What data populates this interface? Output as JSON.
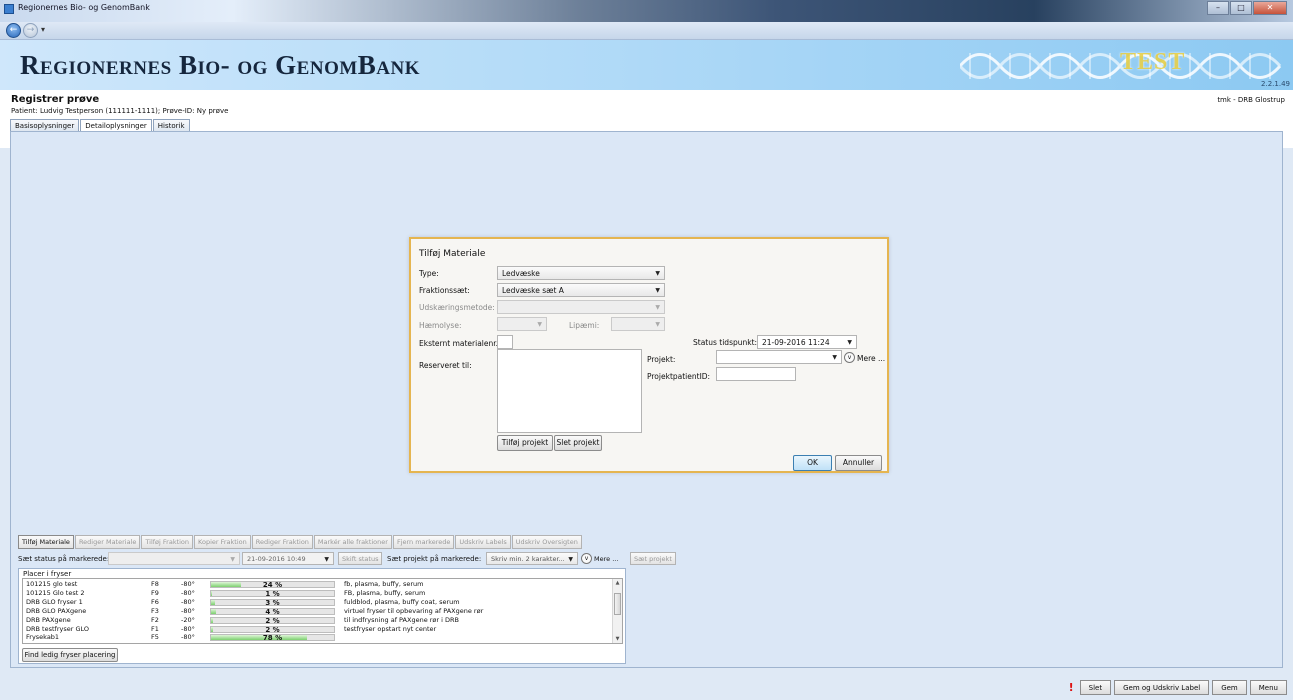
{
  "window": {
    "title": "Regionernes Bio- og GenomBank"
  },
  "nav": {
    "back_glyph": "←",
    "fwd_glyph": "→",
    "dropdown_glyph": "▾"
  },
  "banner": {
    "brand": "Regionernes Bio- og GenomBank",
    "test_badge": "TEST",
    "version": "2.2.1.49"
  },
  "page": {
    "title": "Registrer prøve",
    "patient": "Patient: Ludvig Testperson (111111-1111); Prøve-ID: Ny prøve",
    "user": "tmk - DRB Glostrup",
    "tabs": [
      "Basisoplysninger",
      "Detailoplysninger",
      "Historik"
    ]
  },
  "dialog": {
    "title": "Tilføj Materiale",
    "type_label": "Type:",
    "type_value": "Ledvæske",
    "fraktion_label": "Fraktionssæt:",
    "fraktion_value": "Ledvæske sæt A",
    "udskaering_label": "Udskæringsmetode:",
    "haemolyse_label": "Hæmolyse:",
    "lipaemi_label": "Lipæmi:",
    "eksternt_label": "Eksternt materialenr.:",
    "status_label": "Status tidspunkt:",
    "status_value": "21-09-2016 11:24",
    "reserveret_label": "Reserveret til:",
    "projekt_label": "Projekt:",
    "mere_label": "Mere ...",
    "projektpatient_label": "ProjektpatientID:",
    "tilfoj_projekt": "Tilføj projekt",
    "slet_projekt": "Slet projekt",
    "ok": "OK",
    "annuller": "Annuller"
  },
  "toolbar": {
    "buttons": [
      {
        "label": "Tilføj Materiale",
        "enabled": true
      },
      {
        "label": "Rediger Materiale",
        "enabled": false
      },
      {
        "label": "Tilføj Fraktion",
        "enabled": false
      },
      {
        "label": "Kopier Fraktion",
        "enabled": false
      },
      {
        "label": "Rediger Fraktion",
        "enabled": false
      },
      {
        "label": "Markér alle fraktioner",
        "enabled": false
      },
      {
        "label": "Fjern markerede",
        "enabled": false
      },
      {
        "label": "Udskriv Labels",
        "enabled": false
      },
      {
        "label": "Udskriv Oversigten",
        "enabled": false
      }
    ],
    "status_label": "Sæt status på markerede:",
    "status_date": "21-09-2016 10:49",
    "skift_status": "Skift status",
    "projekt_label": "Sæt projekt på markerede:",
    "projekt_placeholder": "Skriv min. 2 karakter...",
    "mere_label": "Mere ...",
    "saet_projekt": "Sæt projekt"
  },
  "freezer": {
    "header": "Placer i fryser",
    "rows": [
      {
        "name": "101215 glo test",
        "code": "F8",
        "temp": "-80°",
        "pct": 24,
        "pct_label": "24 %",
        "desc": "fb, plasma, buffy, serum"
      },
      {
        "name": "101215 Glo test 2",
        "code": "F9",
        "temp": "-80°",
        "pct": 1,
        "pct_label": "1 %",
        "desc": "FB, plasma, buffy, serum"
      },
      {
        "name": "DRB GLO fryser 1",
        "code": "F6",
        "temp": "-80°",
        "pct": 3,
        "pct_label": "3 %",
        "desc": "fuldblod, plasma, buffy coat, serum"
      },
      {
        "name": "DRB GLO PAXgene",
        "code": "F3",
        "temp": "-80°",
        "pct": 4,
        "pct_label": "4 %",
        "desc": "virtuel fryser til opbevaring af PAXgene rør"
      },
      {
        "name": "DRB PAXgene",
        "code": "F2",
        "temp": "-20°",
        "pct": 2,
        "pct_label": "2 %",
        "desc": "til indfrysning af PAXgene rør i DRB"
      },
      {
        "name": "DRB testfryser GLO",
        "code": "F1",
        "temp": "-80°",
        "pct": 2,
        "pct_label": "2 %",
        "desc": "testfryser opstart nyt center"
      },
      {
        "name": "Frysekab1",
        "code": "F5",
        "temp": "-80°",
        "pct": 78,
        "pct_label": "78 %",
        "desc": ""
      }
    ],
    "find_button": "Find ledig fryser placering"
  },
  "actions": {
    "warning": "!",
    "slet": "Slet",
    "gem_udskriv": "Gem og Udskriv Label",
    "gem": "Gem",
    "menu": "Menu"
  },
  "colors": {
    "accent": "#e5b550",
    "banner": "#b5dcf8",
    "bar_fill": "#7dd06f"
  }
}
